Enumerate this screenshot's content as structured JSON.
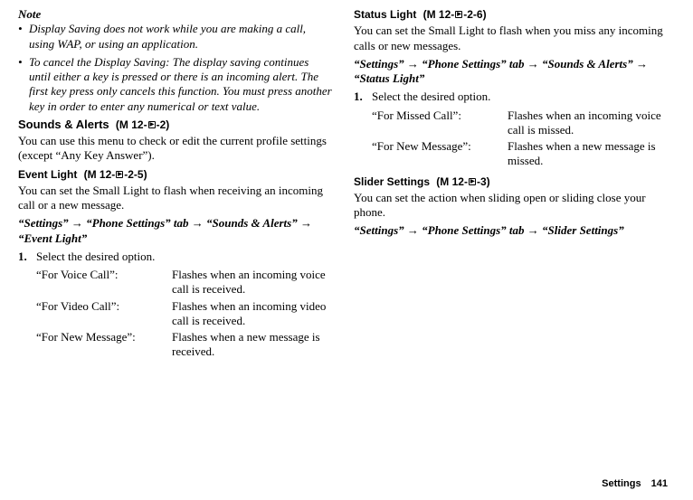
{
  "left": {
    "noteLabel": "Note",
    "notes": [
      "Display Saving does not work while you are making a call, using WAP, or using an application.",
      "To cancel the Display Saving: The display saving continues until either a key is pressed or there is an incoming alert. The first key press only cancels this function. You must press another key in order to enter any numerical or text value."
    ],
    "soundsAlerts": {
      "title": "Sounds & Alerts",
      "codePrefix": "(M 12-",
      "codeSuffix": "-2)",
      "desc": "You can use this menu to check or edit the current profile settings (except “Any Key Answer”)."
    },
    "eventLight": {
      "title": "Event Light",
      "codePrefix": "(M 12-",
      "codeSuffix": "-2-5)",
      "desc": "You can set the Small Light to flash when receiving an incoming call or a new message.",
      "navParts": [
        "“Settings”",
        "“Phone Settings” tab",
        "“Sounds & Alerts”",
        "“Event Light”"
      ],
      "step1": "Select the desired option.",
      "options": [
        {
          "k": "“For Voice Call”:",
          "v": "Flashes when an incoming voice call is received."
        },
        {
          "k": "“For Video Call”:",
          "v": "Flashes when an incoming video call is received."
        },
        {
          "k": "“For New Message”:",
          "v": "Flashes when a new message is received."
        }
      ]
    }
  },
  "right": {
    "statusLight": {
      "title": "Status Light",
      "codePrefix": "(M 12-",
      "codeSuffix": "-2-6)",
      "desc": "You can set the Small Light to flash when you miss any incoming calls or new messages.",
      "navParts": [
        "“Settings”",
        "“Phone Settings” tab",
        "“Sounds & Alerts”",
        "“Status Light”"
      ],
      "step1": "Select the desired option.",
      "options": [
        {
          "k": "“For Missed Call”:",
          "v": "Flashes when an incoming voice call is missed."
        },
        {
          "k": "“For New Message”:",
          "v": "Flashes when a new message is missed."
        }
      ]
    },
    "sliderSettings": {
      "title": "Slider Settings",
      "codePrefix": "(M 12-",
      "codeSuffix": "-3)",
      "desc": "You can set the action when sliding open or sliding close your phone.",
      "navParts": [
        "“Settings”",
        "“Phone Settings” tab",
        "“Slider Settings”"
      ]
    }
  },
  "footer": {
    "label": "Settings",
    "page": "141"
  }
}
